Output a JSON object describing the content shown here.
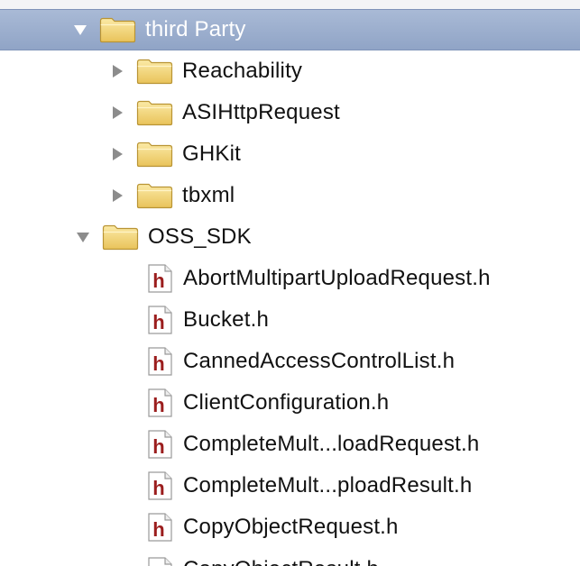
{
  "tree": {
    "third_party": {
      "label": "third Party",
      "children": [
        {
          "label": "Reachability"
        },
        {
          "label": "ASIHttpRequest"
        },
        {
          "label": "GHKit"
        },
        {
          "label": "tbxml"
        }
      ]
    },
    "oss_sdk": {
      "label": "OSS_SDK",
      "files": [
        {
          "label": "AbortMultipartUploadRequest.h"
        },
        {
          "label": "Bucket.h"
        },
        {
          "label": "CannedAccessControlList.h"
        },
        {
          "label": "ClientConfiguration.h"
        },
        {
          "label": "CompleteMult...loadRequest.h"
        },
        {
          "label": "CompleteMult...ploadResult.h"
        },
        {
          "label": "CopyObjectRequest.h"
        },
        {
          "label": "CopyObjectResult.h"
        }
      ]
    }
  },
  "icons": {
    "folder": "folder-icon",
    "header_file": "header-file-icon",
    "expanded": "disclosure-triangle-down-icon",
    "collapsed": "disclosure-triangle-right-icon"
  },
  "colors": {
    "selection": "#98abcc",
    "folder": "#f3d57a",
    "header_glyph": "#9b1d1d"
  }
}
